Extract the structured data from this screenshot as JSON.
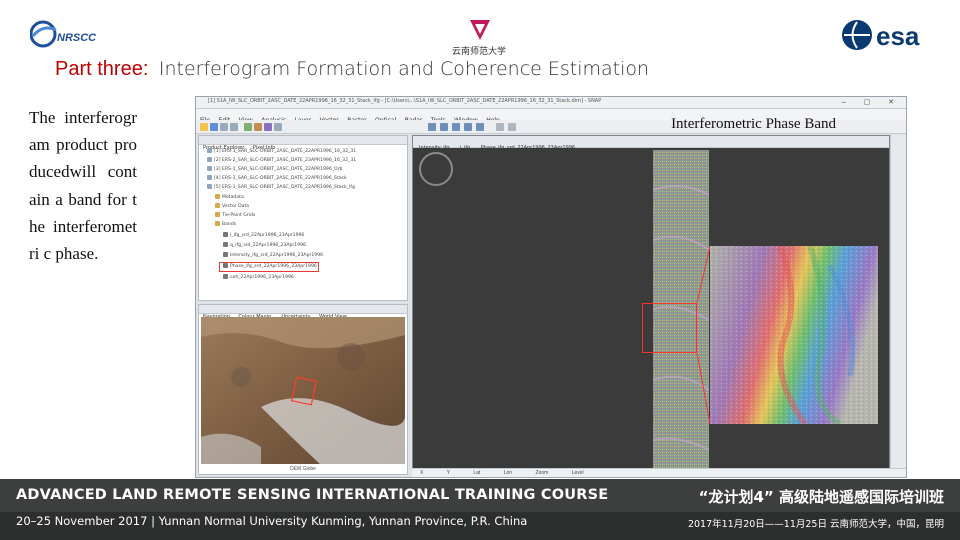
{
  "logos": {
    "left": {
      "text": "NRSCC",
      "color": "#1f4e9c"
    },
    "center": {
      "text": "云南师范大学",
      "color": "#c0195c"
    },
    "right": {
      "text": "esa",
      "color": "#0b3a70"
    }
  },
  "title": {
    "part": "Part three:",
    "rest": "Interferogram Formation and Coherence Estimation",
    "part_color": "#c00000"
  },
  "body_text": "The interferogram product producedwill contain a band for the interferometri c phase.",
  "screenshot": {
    "window_title": "[1] S1A_IW_SLC_ORBIT_2ASC_DATE_22APR1996_16_32_31_Stack_Ifg - [C:\\Users\\...\\S1A_IW_SLC_ORBIT_2ASC_DATE_22APR1996_16_32_31_Stack.dim] - SNAP",
    "annotation": "Interferometric Phase Band",
    "menu": [
      "File",
      "Edit",
      "View",
      "Analysis",
      "Layer",
      "Vector",
      "Raster",
      "Optical",
      "Radar",
      "Tools",
      "Window",
      "Help"
    ],
    "product_tabs": [
      "Product Explorer",
      "Pixel Info"
    ],
    "tree": [
      "[1] ERS-1_SAR_SLC-ORBIT_2ASC_DATE_22APR1996_16_32_31",
      "[2] ERS-2_SAR_SLC-ORBIT_2ASC_DATE_23APR1996_16_32_31",
      "[3] ERS-1_SAR_SLC-ORBIT_2ASC_DATE_22APR1996_Orb",
      "[4] ERS-1_SAR_SLC-ORBIT_2ASC_DATE_22APR1996_Stack",
      "[5] ERS-1_SAR_SLC-ORBIT_2ASC_DATE_22APR1996_Stack_Ifg",
      "Metadata",
      "Vector Data",
      "Tie-Point Grids",
      "Bands",
      "i_ifg_srd_22Apr1996_23Apr1996",
      "q_ifg_srd_22Apr1996_23Apr1996",
      "Intensity_ifg_srd_22Apr1996_23Apr1996",
      "Phase_ifg_srd_22Apr1996_23Apr1996",
      "coh_22Apr1996_23Apr1996"
    ],
    "world_tabs": [
      "Navigation",
      "Colour Manip.",
      "Uncertainty",
      "World View"
    ],
    "world_footer": "DEM Globe",
    "image_tabs": [
      "Intensity_ifg",
      "i_ifg",
      "Phase_ifg_srd_22Apr1996_23Apr1996"
    ],
    "side_tabs": [
      "Product Library",
      "Layer Manager",
      "Mask Manager"
    ],
    "status": [
      "X",
      "Y",
      "Lat",
      "Lon",
      "Zoom",
      "Level"
    ]
  },
  "footer": {
    "course_en": "ADVANCED LAND REMOTE SENSING INTERNATIONAL TRAINING COURSE",
    "course_zh": "“龙计划4” 高级陆地遥感国际培训班",
    "date_en": "20–25 November 2017 | Yunnan Normal University Kunming, Yunnan Province, P.R. China",
    "date_zh": "2017年11月20日——11月25日  云南师范大学，中国，昆明"
  }
}
